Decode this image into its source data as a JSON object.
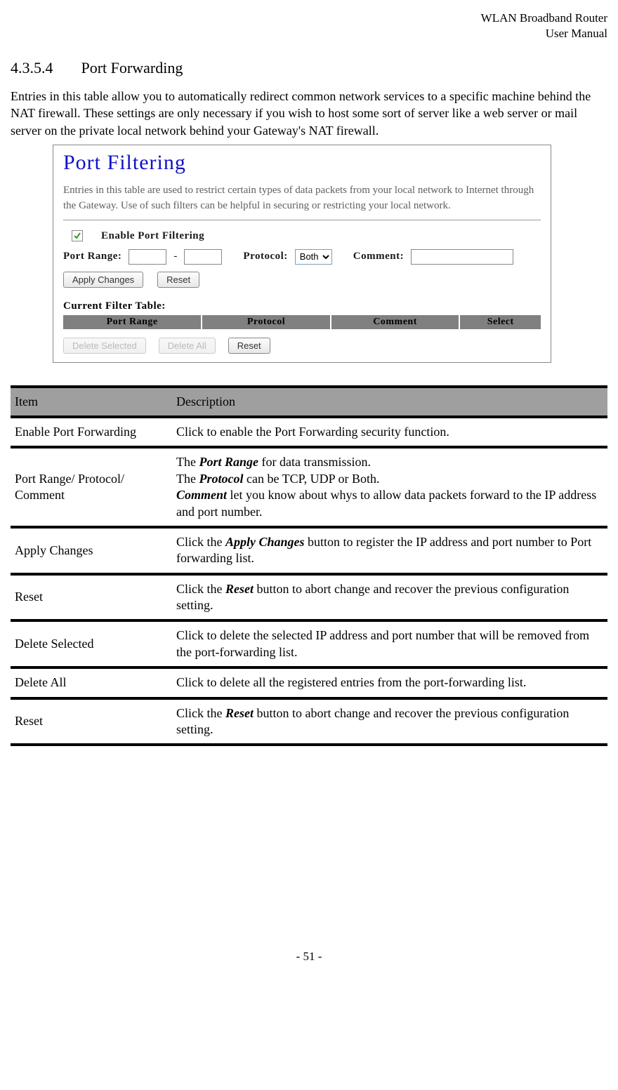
{
  "header": {
    "line1": "WLAN  Broadband  Router",
    "line2": "User  Manual"
  },
  "section": {
    "number": "4.3.5.4",
    "title": "Port Forwarding"
  },
  "intro": "Entries in this table allow you to automatically redirect common network services to a specific machine behind the NAT firewall. These settings are only necessary if you wish to host some sort of server like a web server or mail server on the private local network behind your Gateway's NAT firewall.",
  "screenshot": {
    "title": "Port Filtering",
    "desc": "Entries in this table are used to restrict certain types of data packets from your local network to Internet through the Gateway. Use of such filters can be helpful in securing or restricting your local network.",
    "enable_label": "Enable Port Filtering",
    "port_range_label": "Port Range:",
    "dash": "-",
    "protocol_label": "Protocol:",
    "protocol_value": "Both",
    "comment_label": "Comment:",
    "apply_btn": "Apply Changes",
    "reset_btn": "Reset",
    "filter_table_title": "Current Filter Table:",
    "table_headers": {
      "port_range": "Port Range",
      "protocol": "Protocol",
      "comment": "Comment",
      "select": "Select"
    },
    "delete_selected_btn": "Delete Selected",
    "delete_all_btn": "Delete All",
    "reset2_btn": "Reset"
  },
  "desc_table": {
    "head_item": "Item",
    "head_desc": "Description",
    "rows": [
      {
        "item": "Enable Port Forwarding",
        "desc_html": "Click to enable the Port Forwarding security function."
      },
      {
        "item": "Port Range/ Protocol/ Comment",
        "desc_html": "The <b><i>Port Range</i></b> for data transmission.<br>The <b><i>Protocol</i></b> can be TCP, UDP or Both.<br><b><i>Comment</i></b> let you know about whys to allow data packets forward to the IP address and port number."
      },
      {
        "item": "Apply Changes",
        "desc_html": "Click the <b><i>Apply Changes</i></b> button to register the IP address and port number to Port forwarding list."
      },
      {
        "item": "Reset",
        "desc_html": "Click the <b><i>Reset</i></b> button to abort change and recover the previous configuration setting."
      },
      {
        "item": "Delete Selected",
        "desc_html": "Click to delete the selected IP address and port number that will be removed from the port-forwarding list."
      },
      {
        "item": "Delete All",
        "desc_html": "Click to delete all the registered entries from the port-forwarding list."
      },
      {
        "item": "Reset",
        "desc_html": "Click the <b><i>Reset</i></b> button to abort change and recover the previous configuration setting."
      }
    ]
  },
  "footer": "- 51 -"
}
